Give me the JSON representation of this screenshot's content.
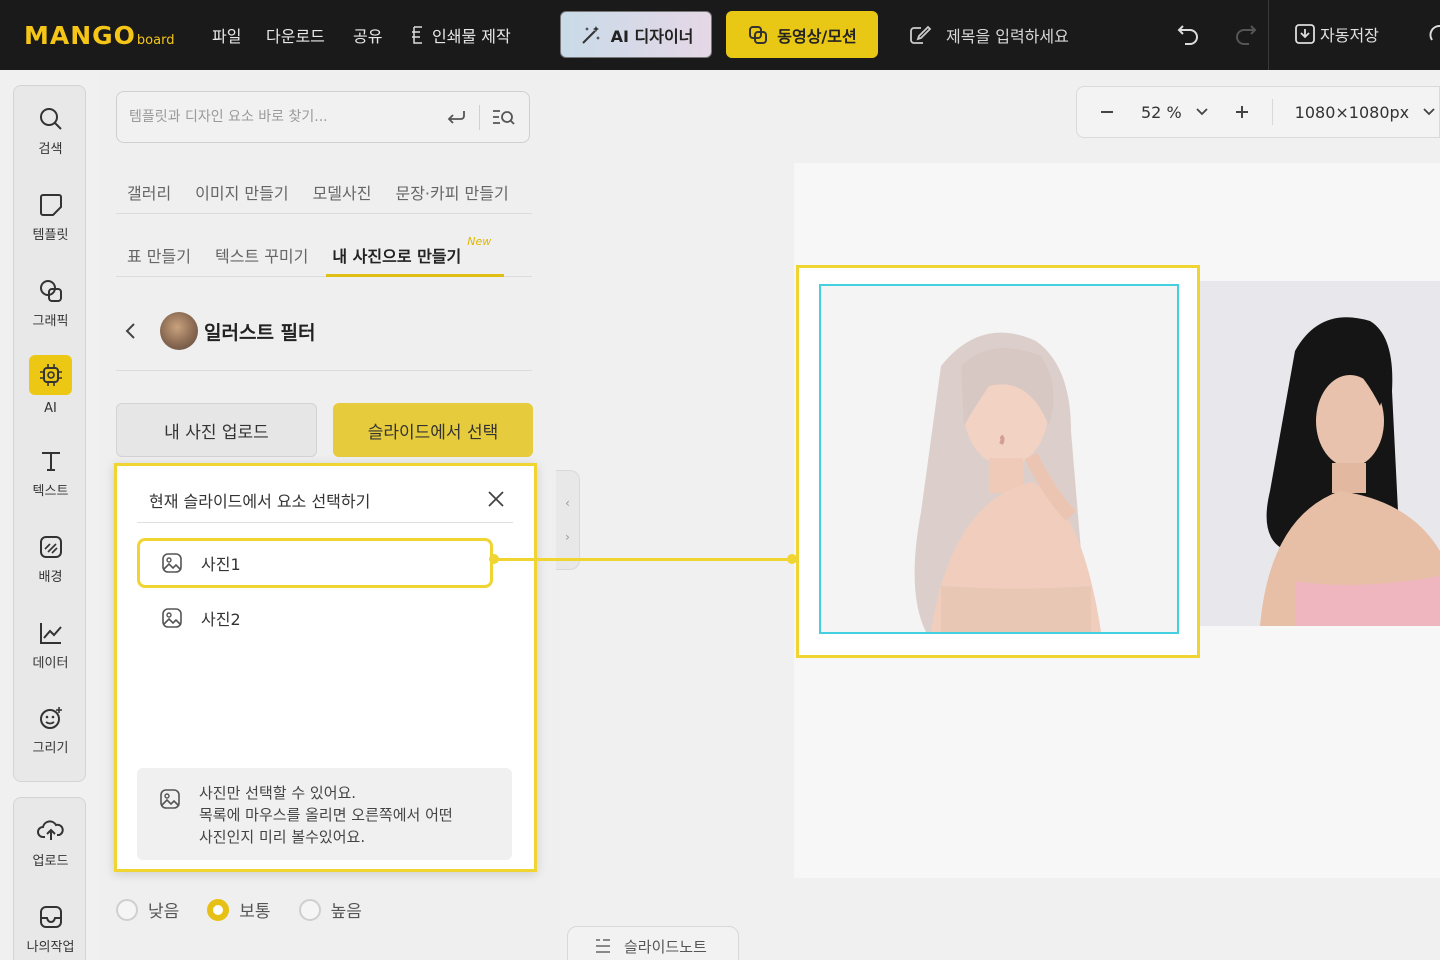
{
  "app": {
    "logo_main": "MANGO",
    "logo_sub": "board",
    "brand_color": "#f5c518"
  },
  "topbar": {
    "menus": [
      "파일",
      "다운로드",
      "공유",
      "인쇄물 제작"
    ],
    "ai_designer": "AI 디자이너",
    "video_motion": "동영상/모션",
    "title_placeholder": "제목을 입력하세요",
    "autosave": "자동저장"
  },
  "sidebar": {
    "items": [
      "검색",
      "템플릿",
      "그래픽",
      "AI",
      "텍스트",
      "배경",
      "데이터",
      "그리기"
    ],
    "bottom_items": [
      "업로드",
      "나의작업"
    ]
  },
  "panel": {
    "search_placeholder": "템플릿과 디자인 요소 바로 찾기...",
    "tabs_row1": [
      "갤러리",
      "이미지 만들기",
      "모델사진",
      "문장·카피 만들기"
    ],
    "tabs_row2": [
      "표 만들기",
      "텍스트 꾸미기",
      "내 사진으로 만들기"
    ],
    "new_badge": "New",
    "filter_title": "일러스트 필터",
    "upload_btn": "내 사진 업로드",
    "select_btn": "슬라이드에서 선택",
    "strength_options": [
      "낮음",
      "보통",
      "높음"
    ],
    "strength_selected": "보통"
  },
  "popup": {
    "title": "현재 슬라이드에서 요소 선택하기",
    "items": [
      "사진1",
      "사진2"
    ],
    "selected_item": "사진1",
    "note_lines": [
      "사진만 선택할 수 있어요.",
      "목록에 마우스를 올리면 오른쪽에서 어떤",
      "사진인지 미리 볼수있어요."
    ]
  },
  "canvas": {
    "zoom": "52 %",
    "size": "1080×1080px"
  },
  "footer": {
    "notes_tab": "슬라이드노트"
  }
}
